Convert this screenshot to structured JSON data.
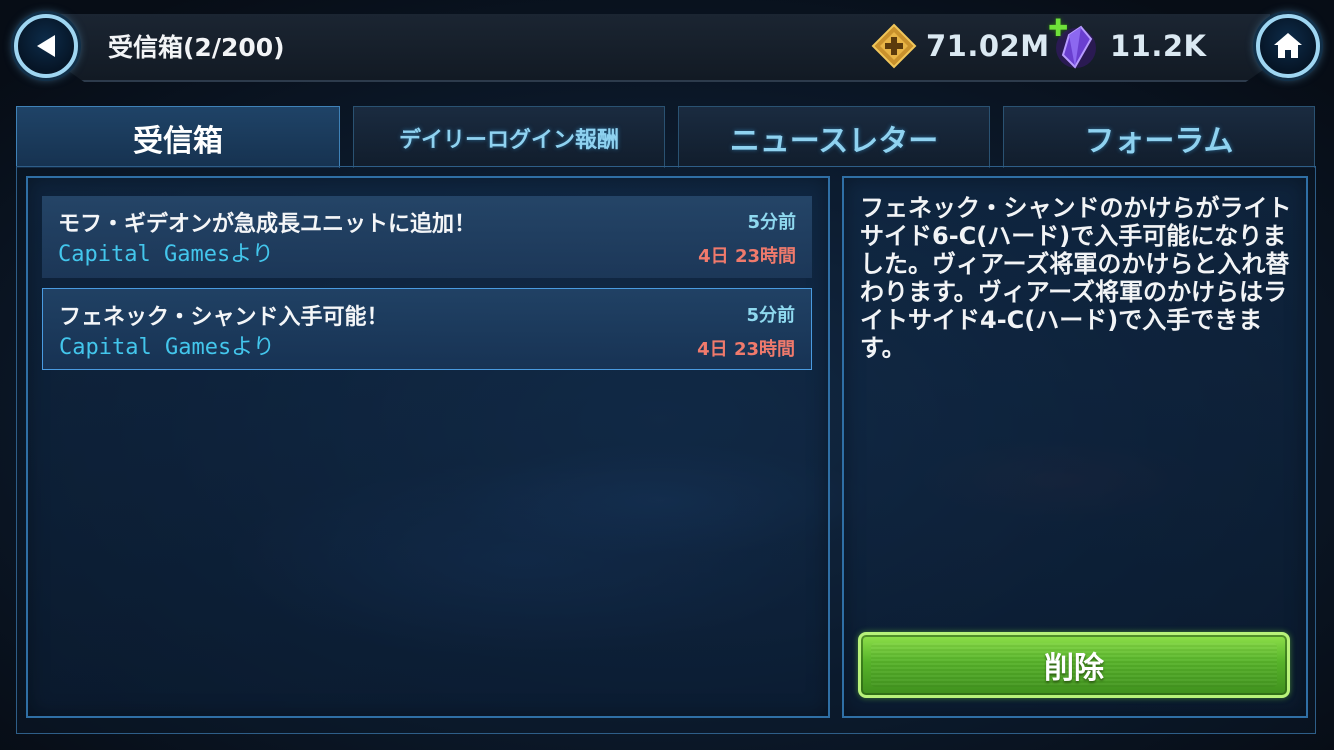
{
  "header": {
    "title": "受信箱(2/200)",
    "back_icon": "back-arrow-icon",
    "home_icon": "home-icon"
  },
  "currencies": {
    "credits": {
      "icon": "credits-icon",
      "amount": "71.02M"
    },
    "crystals": {
      "icon": "crystal-icon",
      "amount": "11.2K",
      "add_icon": "plus-icon"
    }
  },
  "tabs": [
    {
      "label": "受信箱",
      "active": true
    },
    {
      "label": "デイリーログイン報酬",
      "active": false
    },
    {
      "label": "ニュースレター",
      "active": false
    },
    {
      "label": "フォーラム",
      "active": false
    }
  ],
  "messages": [
    {
      "title": "モフ・ギデオンが急成長ユニットに追加！",
      "sender": "Capital Gamesより",
      "time": "5分前",
      "expires": "4日 23時間",
      "selected": false
    },
    {
      "title": "フェネック・シャンド入手可能！",
      "sender": "Capital Gamesより",
      "time": "5分前",
      "expires": "4日 23時間",
      "selected": true
    }
  ],
  "detail": {
    "body": "フェネック・シャンドのかけらがライトサイド6-C(ハード)で入手可能になりました。ヴィアーズ将軍のかけらと入れ替わります。ヴィアーズ将軍のかけらはライトサイド4-C(ハード)で入手できます。",
    "delete_label": "削除"
  },
  "colors": {
    "accent_cyan": "#43c6ec",
    "expire_red": "#f07a6c",
    "delete_green": "#57b32a"
  }
}
